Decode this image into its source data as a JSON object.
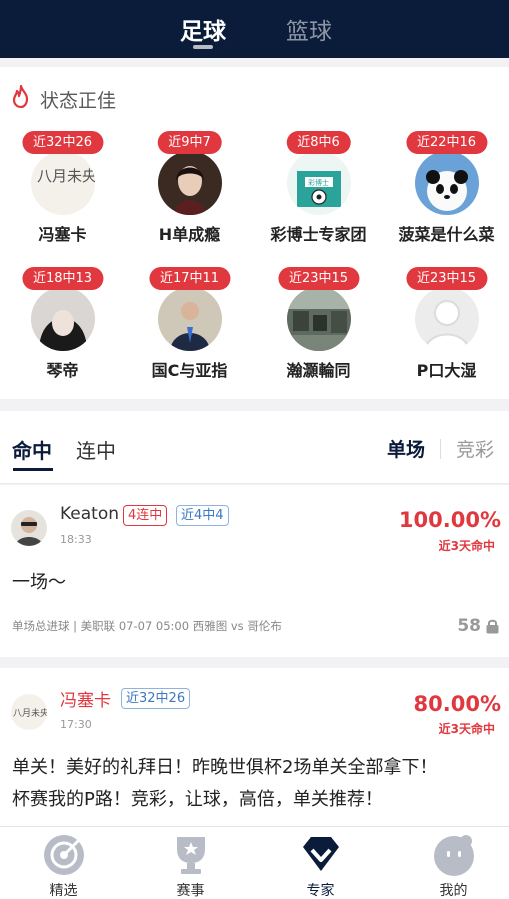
{
  "header": {
    "tab_football": "足球",
    "tab_basketball": "篮球"
  },
  "hot": {
    "title": "状态正佳",
    "experts": [
      {
        "badge": "近32中26",
        "name": "冯塞卡"
      },
      {
        "badge": "近9中7",
        "name": "H单成瘾"
      },
      {
        "badge": "近8中6",
        "name": "彩博士专家团"
      },
      {
        "badge": "近22中16",
        "name": "菠菜是什么菜"
      },
      {
        "badge": "近18中13",
        "name": "琴帝"
      },
      {
        "badge": "近17中11",
        "name": "国C与亚指"
      },
      {
        "badge": "近23中15",
        "name": "瀚灝輪同"
      },
      {
        "badge": "近23中15",
        "name": "P口大湿"
      }
    ],
    "logo_text": "彩博士",
    "avatar_calligraphy": "八月未央"
  },
  "tabs": {
    "hit": "命中",
    "streak": "连中",
    "single": "单场",
    "jingcai": "竞彩"
  },
  "posts": [
    {
      "name": "Keaton",
      "tag1": "4连中",
      "tag2": "近4中4",
      "time": "18:33",
      "rate": "100.00%",
      "rate_label": "近3天命中",
      "content": "一场～",
      "meta": "单场总进球 | 美职联 07-07 05:00 西雅图 vs 哥伦布",
      "count": "58"
    },
    {
      "name": "冯塞卡",
      "tag1": "近32中26",
      "time": "17:30",
      "rate": "80.00%",
      "rate_label": "近3天命中",
      "content_line1": "单关！美好的礼拜日！昨晚世俱杯2场单关全部拿下！",
      "content_line2": "杯赛我的P路！竞彩，让球，高倍，单关推荐！"
    }
  ],
  "nav": {
    "items": [
      {
        "label": "精选"
      },
      {
        "label": "赛事"
      },
      {
        "label": "专家"
      },
      {
        "label": "我的"
      }
    ]
  },
  "colors": {
    "header_bg": "#0a1c3a",
    "accent_red": "#e0383e",
    "tag_blue": "#3a78c2"
  }
}
